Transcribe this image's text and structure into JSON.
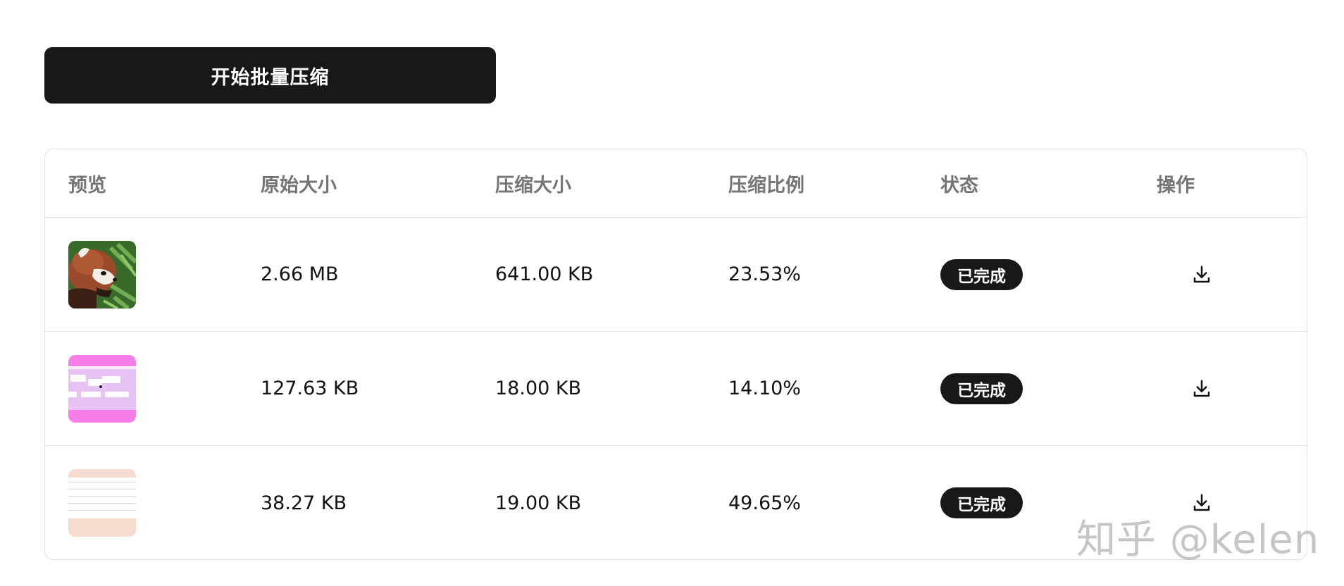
{
  "toolbar": {
    "start_label": "开始批量压缩"
  },
  "table": {
    "headers": {
      "preview": "预览",
      "original_size": "原始大小",
      "compressed_size": "压缩大小",
      "ratio": "压缩比例",
      "status": "状态",
      "action": "操作"
    },
    "rows": [
      {
        "thumbnail": "red-panda-photo",
        "original_size": "2.66 MB",
        "compressed_size": "641.00 KB",
        "ratio": "23.53%",
        "status": "已完成",
        "action_icon": "download-icon"
      },
      {
        "thumbnail": "pink-ui-screenshot",
        "original_size": "127.63 KB",
        "compressed_size": "18.00 KB",
        "ratio": "14.10%",
        "status": "已完成",
        "action_icon": "download-icon"
      },
      {
        "thumbnail": "peach-lined-document",
        "original_size": "38.27 KB",
        "compressed_size": "19.00 KB",
        "ratio": "49.65%",
        "status": "已完成",
        "action_icon": "download-icon"
      }
    ]
  },
  "watermark": "知乎 @kelen",
  "colors": {
    "primary": "#181818",
    "header_text": "#747474",
    "border": "#e2e2e2",
    "badge_text": "#ffffff"
  }
}
